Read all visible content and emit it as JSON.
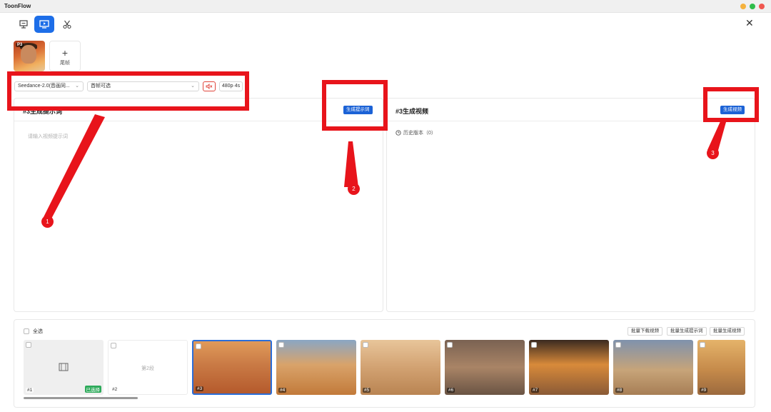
{
  "app": {
    "title": "ToonFlow"
  },
  "toolbar": {
    "tools": [
      {
        "name": "storyboard",
        "active": false
      },
      {
        "name": "video",
        "active": true
      },
      {
        "name": "edit",
        "active": false
      }
    ]
  },
  "frames": {
    "first_badge": "P3",
    "tail_label": "尾帧"
  },
  "controls": {
    "model_select": "Seedance-2.0(音画同...",
    "frame_select": "首帧可选",
    "resolution": "480p·4s"
  },
  "left_panel": {
    "title": "#3生成提示词",
    "button": "生成提示词",
    "placeholder": "请输入视频提示词"
  },
  "right_panel": {
    "title": "#3生成视频",
    "button": "生成视频",
    "history": "历史版本（0）"
  },
  "annotations": [
    "1",
    "2",
    "3"
  ],
  "bottom": {
    "select_all": "全选",
    "buttons": [
      "批量下载视频",
      "批量生成提示词",
      "批量生成视频"
    ],
    "clips": [
      {
        "num": "#1",
        "badge": "已选择"
      },
      {
        "num": "#2",
        "label": "第2段"
      },
      {
        "num": "#3"
      },
      {
        "num": "#4"
      },
      {
        "num": "#5"
      },
      {
        "num": "#6"
      },
      {
        "num": "#7"
      },
      {
        "num": "#8"
      },
      {
        "num": "#9"
      }
    ]
  },
  "colors": {
    "accent": "#1b62d6",
    "annotation": "#e8141b",
    "chosen": "#2daa5a",
    "mute": "#e0453c"
  }
}
